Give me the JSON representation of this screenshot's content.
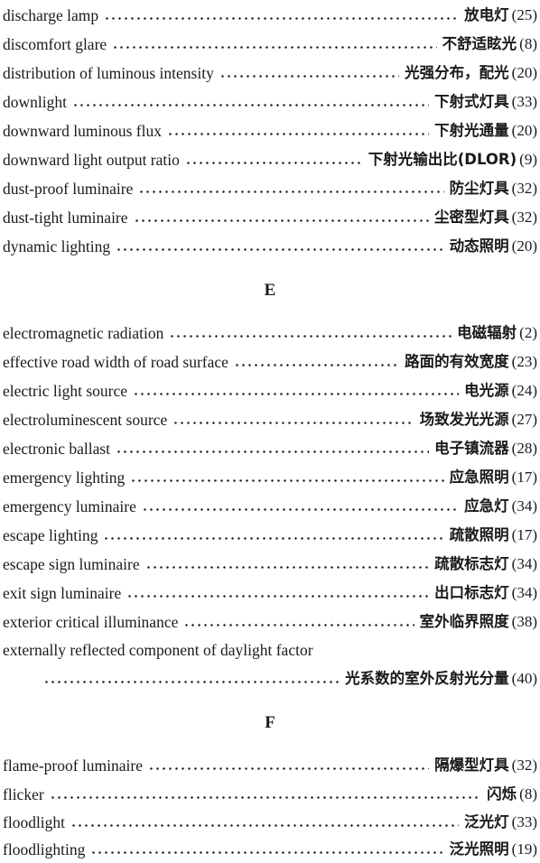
{
  "entries_d": [
    {
      "en": "discharge lamp",
      "zh": "放电灯",
      "page": "(25)"
    },
    {
      "en": "discomfort glare",
      "zh": "不舒适眩光",
      "page": "(8)"
    },
    {
      "en": "distribution of luminous intensity",
      "zh": "光强分布，配光",
      "page": "(20)"
    },
    {
      "en": "downlight",
      "zh": "下射式灯具",
      "page": "(33)"
    },
    {
      "en": "downward luminous flux",
      "zh": "下射光通量",
      "page": "(20)"
    },
    {
      "en": "downward light output ratio",
      "zh": "下射光输出比(DLOR)",
      "page": "(9)"
    },
    {
      "en": "dust-proof luminaire",
      "zh": "防尘灯具",
      "page": "(32)"
    },
    {
      "en": "dust-tight luminaire",
      "zh": "尘密型灯具",
      "page": "(32)"
    },
    {
      "en": "dynamic lighting",
      "zh": "动态照明",
      "page": "(20)"
    }
  ],
  "section_e": "E",
  "entries_e": [
    {
      "en": "electromagnetic radiation",
      "zh": "电磁辐射",
      "page": "(2)"
    },
    {
      "en": "effective road width of road surface",
      "zh": "路面的有效宽度",
      "page": "(23)"
    },
    {
      "en": "electric light source",
      "zh": "电光源",
      "page": "(24)"
    },
    {
      "en": "electroluminescent source",
      "zh": "场致发光光源",
      "page": "(27)"
    },
    {
      "en": "electronic ballast",
      "zh": "电子镇流器",
      "page": "(28)"
    },
    {
      "en": "emergency lighting",
      "zh": "应急照明",
      "page": "(17)"
    },
    {
      "en": "emergency luminaire",
      "zh": "应急灯",
      "page": "(34)"
    },
    {
      "en": "escape lighting",
      "zh": "疏散照明",
      "page": "(17)"
    },
    {
      "en": "escape sign luminaire",
      "zh": "疏散标志灯",
      "page": "(34)"
    },
    {
      "en": "exit sign luminaire",
      "zh": "出口标志灯",
      "page": "(34)"
    },
    {
      "en": "exterior critical illuminance",
      "zh": "室外临界照度",
      "page": "(38)"
    }
  ],
  "entry_e_long": {
    "en": "externally reflected component of daylight factor",
    "zh": "光系数的室外反射光分量",
    "page": "(40)"
  },
  "section_f": "F",
  "entries_f": [
    {
      "en": "flame-proof luminaire",
      "zh": "隔爆型灯具",
      "page": "(32)"
    },
    {
      "en": "flicker",
      "zh": "闪烁",
      "page": "(8)"
    },
    {
      "en": "floodlight",
      "zh": "泛光灯",
      "page": "(33)"
    },
    {
      "en": "floodlighting",
      "zh": "泛光照明",
      "page": "(19)"
    }
  ]
}
